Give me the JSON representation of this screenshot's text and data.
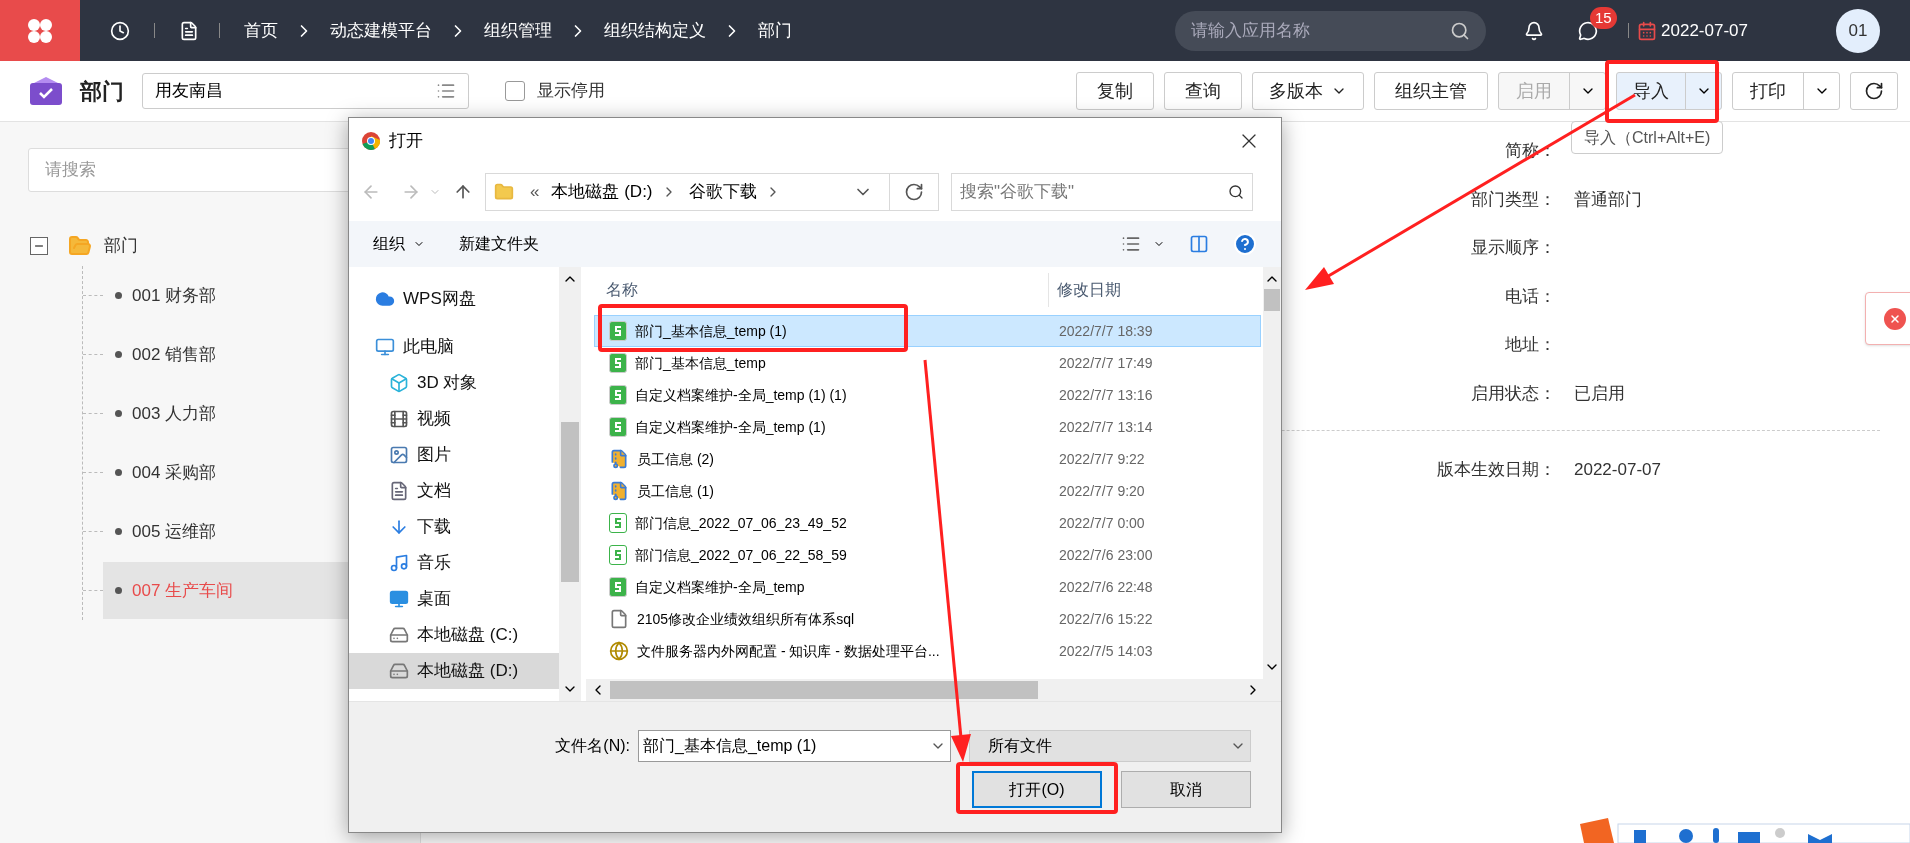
{
  "top_bar": {
    "breadcrumbs": [
      "首页",
      "动态建模平台",
      "组织管理",
      "组织结构定义",
      "部门"
    ],
    "search": {
      "placeholder": "请输入应用名称"
    },
    "message_badge": "15",
    "date": "2022-07-07",
    "avatar": "01"
  },
  "toolbar": {
    "title": "部门",
    "org_select": {
      "value": "用友南昌"
    },
    "show_disabled": {
      "label": "显示停用",
      "checked": false
    },
    "buttons": [
      {
        "label": "复制",
        "kind": "plain",
        "disabled": false,
        "hovered": false
      },
      {
        "label": "查询",
        "kind": "plain",
        "disabled": false,
        "hovered": false
      },
      {
        "label": "多版本",
        "kind": "menu",
        "disabled": false,
        "hovered": false
      },
      {
        "label": "组织主管",
        "kind": "plain",
        "disabled": false,
        "hovered": false
      },
      {
        "label": "启用",
        "kind": "split",
        "disabled": true,
        "hovered": false
      },
      {
        "label": "导入",
        "kind": "split",
        "disabled": false,
        "hovered": true
      },
      {
        "label": "打印",
        "kind": "split",
        "disabled": false,
        "hovered": false
      },
      {
        "kind": "refresh",
        "disabled": false,
        "hovered": false
      }
    ],
    "tooltip": "导入（Ctrl+Alt+E)"
  },
  "tree": {
    "search": {
      "placeholder": "请搜索"
    },
    "root": {
      "label": "部门",
      "expanded": true,
      "children": [
        {
          "label": "001 财务部",
          "selected": false
        },
        {
          "label": "002 销售部",
          "selected": false
        },
        {
          "label": "003 人力部",
          "selected": false
        },
        {
          "label": "004 采购部",
          "selected": false
        },
        {
          "label": "005 运维部",
          "selected": false
        },
        {
          "label": "007 生产车间",
          "selected": true
        }
      ]
    }
  },
  "details": {
    "fields": [
      {
        "label": "简称："
      },
      {
        "label": "部门类型：",
        "value": "普通部门"
      },
      {
        "label": "显示顺序："
      },
      {
        "label": "电话："
      },
      {
        "label": "地址："
      },
      {
        "label": "启用状态：",
        "value": "已启用"
      }
    ],
    "version_date": {
      "label": "版本生效日期：",
      "value": "2022-07-07"
    }
  },
  "dialog": {
    "title": "打开",
    "path_overflow": "«",
    "path": [
      "本地磁盘 (D:)",
      "谷歌下载"
    ],
    "search": {
      "placeholder": "搜索\"谷歌下载\""
    },
    "commands": [
      {
        "label": "组织",
        "kind": "menu"
      },
      {
        "label": "新建文件夹",
        "kind": "plain"
      }
    ],
    "nav": [
      {
        "label": "WPS网盘",
        "kind": "cloud",
        "selected": false
      },
      {
        "label": "此电脑",
        "kind": "pc",
        "selected": false,
        "children": [
          {
            "label": "3D 对象",
            "kind": "cube",
            "selected": false
          },
          {
            "label": "视频",
            "kind": "video",
            "selected": false
          },
          {
            "label": "图片",
            "kind": "image",
            "selected": false
          },
          {
            "label": "文档",
            "kind": "document",
            "selected": false
          },
          {
            "label": "下载",
            "kind": "download",
            "selected": false
          },
          {
            "label": "音乐",
            "kind": "music",
            "selected": false
          },
          {
            "label": "桌面",
            "kind": "desktop",
            "selected": false
          },
          {
            "label": "本地磁盘 (C:)",
            "kind": "drive",
            "selected": false
          },
          {
            "label": "本地磁盘 (D:)",
            "kind": "drive",
            "selected": true
          }
        ]
      }
    ],
    "columns": [
      "名称",
      "修改日期"
    ],
    "files": [
      {
        "name": "部门_基本信息_temp (1)",
        "date": "2022/7/7 18:39",
        "kind": "sheet",
        "selected": true
      },
      {
        "name": "部门_基本信息_temp",
        "date": "2022/7/7 17:49",
        "kind": "sheet",
        "selected": false
      },
      {
        "name": "自定义档案维护-全局_temp (1) (1)",
        "date": "2022/7/7 13:16",
        "kind": "sheet",
        "selected": false
      },
      {
        "name": "自定义档案维护-全局_temp (1)",
        "date": "2022/7/7 13:14",
        "kind": "sheet",
        "selected": false
      },
      {
        "name": "员工信息 (2)",
        "date": "2022/7/7 9:22",
        "kind": "archive",
        "selected": false
      },
      {
        "name": "员工信息 (1)",
        "date": "2022/7/7 9:20",
        "kind": "archive",
        "selected": false
      },
      {
        "name": "部门信息_2022_07_06_23_49_52",
        "date": "2022/7/7 0:00",
        "kind": "sheet-outline",
        "selected": false
      },
      {
        "name": "部门信息_2022_07_06_22_58_59",
        "date": "2022/7/6 23:00",
        "kind": "sheet-outline",
        "selected": false
      },
      {
        "name": "自定义档案维护-全局_temp",
        "date": "2022/7/6 22:48",
        "kind": "sheet",
        "selected": false
      },
      {
        "name": "2105修改企业绩效组织所有体系sql",
        "date": "2022/7/6 15:22",
        "kind": "text",
        "selected": false
      },
      {
        "name": "文件服务器内外网配置 - 知识库 - 数据处理平台...",
        "date": "2022/7/5 14:03",
        "kind": "web",
        "selected": false
      }
    ],
    "filename": {
      "label": "文件名(N):",
      "value": "部门_基本信息_temp (1)"
    },
    "filetype": {
      "value": "所有文件"
    },
    "buttons": [
      {
        "label": "打开(O)",
        "kind": "primary"
      },
      {
        "label": "取消",
        "kind": "secondary"
      }
    ]
  }
}
